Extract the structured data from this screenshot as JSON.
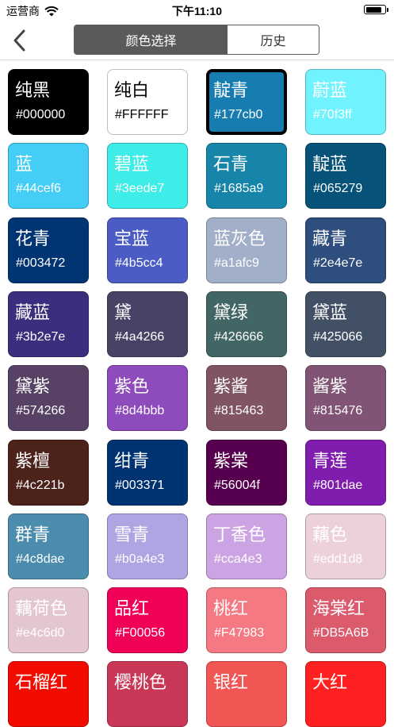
{
  "status_bar": {
    "carrier": "运营商",
    "time": "下午11:10",
    "battery_level": 0.9
  },
  "nav": {
    "back_icon": "chevron-left-icon",
    "tabs": [
      {
        "label": "颜色选择",
        "active": true
      },
      {
        "label": "历史",
        "active": false
      }
    ]
  },
  "colors": [
    {
      "name": "纯黑",
      "hex": "#000000",
      "bg": "#000000",
      "fg": "#ffffff"
    },
    {
      "name": "纯白",
      "hex": "#FFFFFF",
      "bg": "#ffffff",
      "fg": "#000000"
    },
    {
      "name": "靛青",
      "hex": "#177cb0",
      "bg": "#177cb0",
      "fg": "#ffffff",
      "selected": true
    },
    {
      "name": "蔚蓝",
      "hex": "#70f3ff",
      "bg": "#70f3ff",
      "fg": "#ffffff"
    },
    {
      "name": "蓝",
      "hex": "#44cef6",
      "bg": "#44cef6",
      "fg": "#ffffff"
    },
    {
      "name": "碧蓝",
      "hex": "#3eede7",
      "bg": "#3eede7",
      "fg": "#ffffff"
    },
    {
      "name": "石青",
      "hex": "#1685a9",
      "bg": "#1685a9",
      "fg": "#ffffff"
    },
    {
      "name": "靛蓝",
      "hex": "#065279",
      "bg": "#065279",
      "fg": "#ffffff"
    },
    {
      "name": "花青",
      "hex": "#003472",
      "bg": "#003472",
      "fg": "#ffffff"
    },
    {
      "name": "宝蓝",
      "hex": "#4b5cc4",
      "bg": "#4b5cc4",
      "fg": "#ffffff"
    },
    {
      "name": "蓝灰色",
      "hex": "#a1afc9",
      "bg": "#a1afc9",
      "fg": "#ffffff"
    },
    {
      "name": "藏青",
      "hex": "#2e4e7e",
      "bg": "#2e4e7e",
      "fg": "#ffffff"
    },
    {
      "name": "藏蓝",
      "hex": "#3b2e7e",
      "bg": "#3b2e7e",
      "fg": "#ffffff"
    },
    {
      "name": "黛",
      "hex": "#4a4266",
      "bg": "#4a4266",
      "fg": "#ffffff"
    },
    {
      "name": "黛绿",
      "hex": "#426666",
      "bg": "#426666",
      "fg": "#ffffff"
    },
    {
      "name": "黛蓝",
      "hex": "#425066",
      "bg": "#425066",
      "fg": "#ffffff"
    },
    {
      "name": "黛紫",
      "hex": "#574266",
      "bg": "#574266",
      "fg": "#ffffff"
    },
    {
      "name": "紫色",
      "hex": "#8d4bbb",
      "bg": "#8d4bbb",
      "fg": "#ffffff"
    },
    {
      "name": "紫酱",
      "hex": "#815463",
      "bg": "#815463",
      "fg": "#ffffff"
    },
    {
      "name": "酱紫",
      "hex": "#815476",
      "bg": "#815476",
      "fg": "#ffffff"
    },
    {
      "name": "紫檀",
      "hex": "#4c221b",
      "bg": "#4c221b",
      "fg": "#ffffff"
    },
    {
      "name": "绀青",
      "hex": "#003371",
      "bg": "#003371",
      "fg": "#ffffff"
    },
    {
      "name": "紫棠",
      "hex": "#56004f",
      "bg": "#56004f",
      "fg": "#ffffff"
    },
    {
      "name": "青莲",
      "hex": "#801dae",
      "bg": "#801dae",
      "fg": "#ffffff"
    },
    {
      "name": "群青",
      "hex": "#4c8dae",
      "bg": "#4c8dae",
      "fg": "#ffffff"
    },
    {
      "name": "雪青",
      "hex": "#b0a4e3",
      "bg": "#b0a4e3",
      "fg": "#ffffff"
    },
    {
      "name": "丁香色",
      "hex": "#cca4e3",
      "bg": "#cca4e3",
      "fg": "#ffffff"
    },
    {
      "name": "藕色",
      "hex": "#edd1d8",
      "bg": "#edd1d8",
      "fg": "#ffffff"
    },
    {
      "name": "藕荷色",
      "hex": "#e4c6d0",
      "bg": "#e4c6d0",
      "fg": "#ffffff"
    },
    {
      "name": "品红",
      "hex": "#F00056",
      "bg": "#f00056",
      "fg": "#ffffff"
    },
    {
      "name": "桃红",
      "hex": "#F47983",
      "bg": "#f47983",
      "fg": "#ffffff"
    },
    {
      "name": "海棠红",
      "hex": "#DB5A6B",
      "bg": "#db5a6b",
      "fg": "#ffffff"
    },
    {
      "name": "石榴红",
      "hex": "",
      "bg": "#f20c00",
      "fg": "#ffffff"
    },
    {
      "name": "樱桃色",
      "hex": "",
      "bg": "#c93756",
      "fg": "#ffffff"
    },
    {
      "name": "银红",
      "hex": "",
      "bg": "#f05654",
      "fg": "#ffffff"
    },
    {
      "name": "大红",
      "hex": "",
      "bg": "#ff2121",
      "fg": "#ffffff"
    }
  ]
}
